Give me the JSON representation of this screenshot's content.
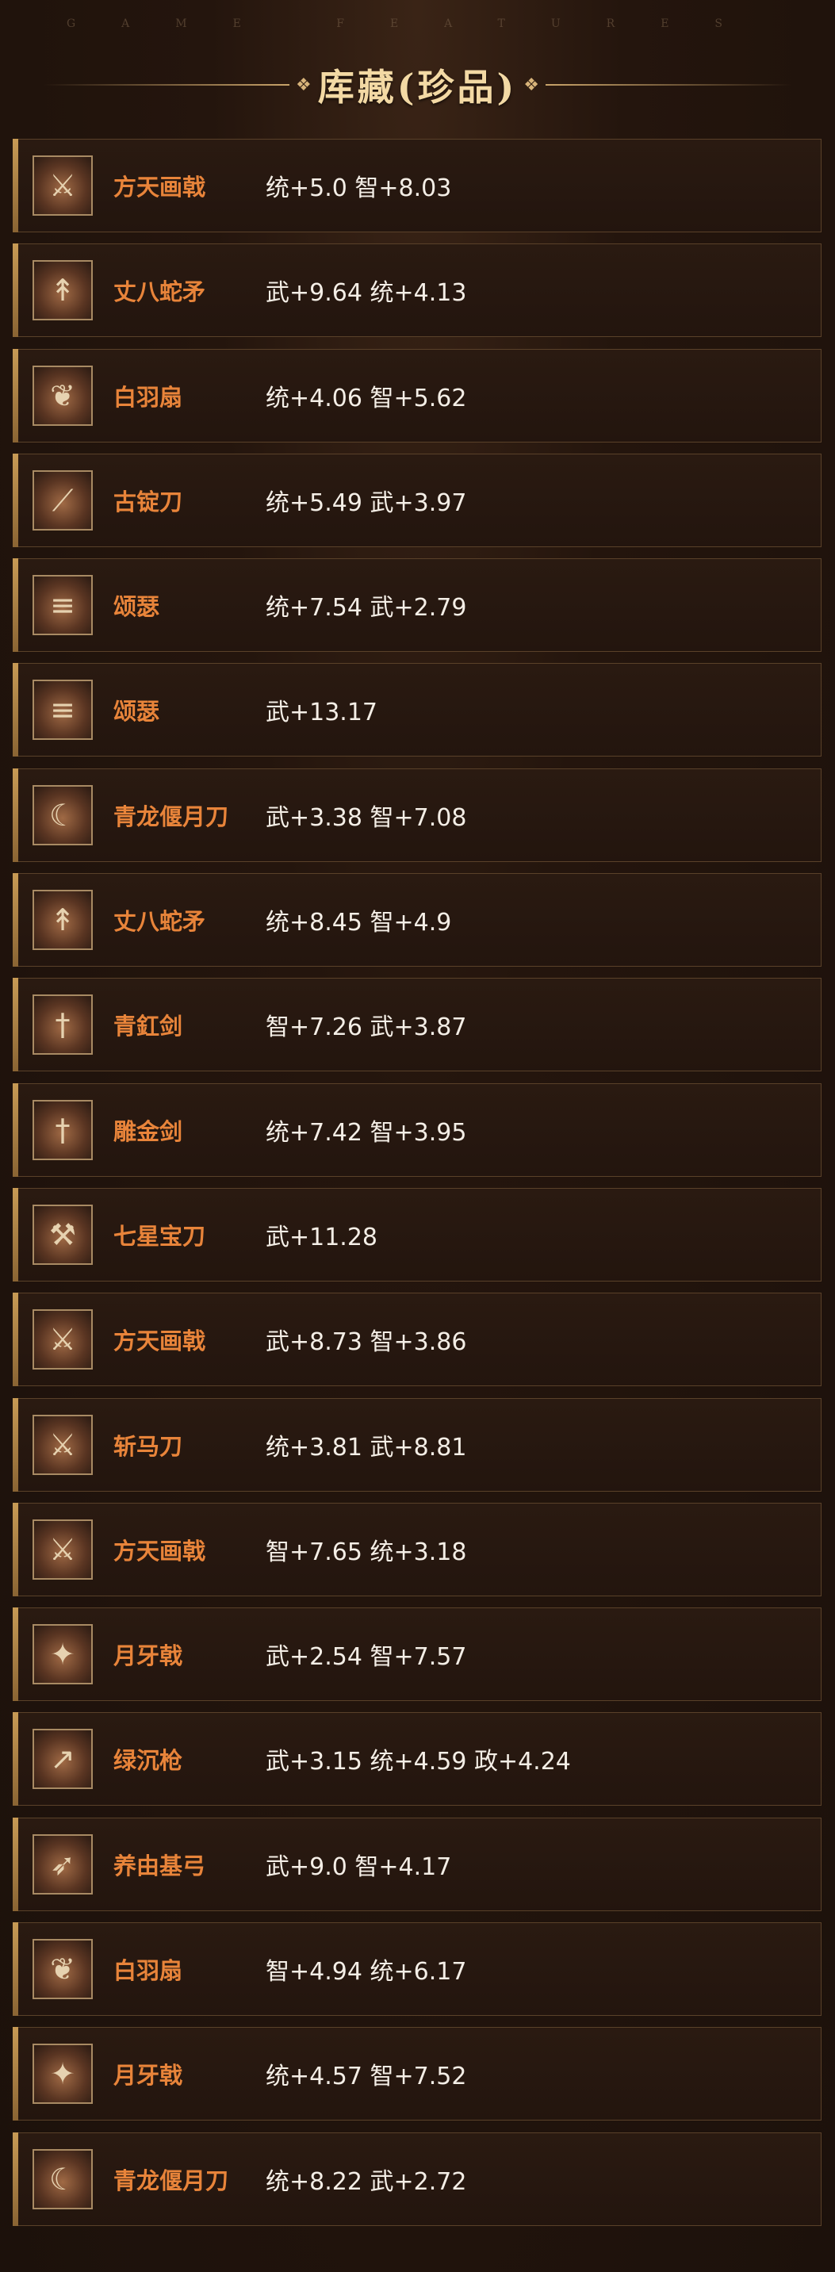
{
  "header": {
    "watermark": "GAME FEATURES",
    "title": "库藏(珍品)"
  },
  "items": [
    {
      "name": "方天画戟",
      "stats": "统+5.0 智+8.03",
      "icon": "halberd-icon"
    },
    {
      "name": "丈八蛇矛",
      "stats": "武+9.64 统+4.13",
      "icon": "serpent-spear-icon"
    },
    {
      "name": "白羽扇",
      "stats": "统+4.06 智+5.62",
      "icon": "feather-fan-icon"
    },
    {
      "name": "古锭刀",
      "stats": "统+5.49 武+3.97",
      "icon": "broadsword-icon"
    },
    {
      "name": "颂瑟",
      "stats": "统+7.54 武+2.79",
      "icon": "zither-icon"
    },
    {
      "name": "颂瑟",
      "stats": "武+13.17",
      "icon": "zither-icon"
    },
    {
      "name": "青龙偃月刀",
      "stats": "武+3.38 智+7.08",
      "icon": "crescent-blade-icon"
    },
    {
      "name": "丈八蛇矛",
      "stats": "统+8.45 智+4.9",
      "icon": "serpent-spear-icon"
    },
    {
      "name": "青釭剑",
      "stats": "智+7.26 武+3.87",
      "icon": "sword-icon"
    },
    {
      "name": "雕金剑",
      "stats": "统+7.42 智+3.95",
      "icon": "sword-icon"
    },
    {
      "name": "七星宝刀",
      "stats": "武+11.28",
      "icon": "dagger-icon"
    },
    {
      "name": "方天画戟",
      "stats": "武+8.73 智+3.86",
      "icon": "halberd-icon"
    },
    {
      "name": "斩马刀",
      "stats": "统+3.81 武+8.81",
      "icon": "horse-cutter-icon"
    },
    {
      "name": "方天画戟",
      "stats": "智+7.65 统+3.18",
      "icon": "halberd-icon"
    },
    {
      "name": "月牙戟",
      "stats": "武+2.54 智+7.57",
      "icon": "crescent-halberd-icon"
    },
    {
      "name": "绿沉枪",
      "stats": "武+3.15 统+4.59 政+4.24",
      "icon": "spear-icon"
    },
    {
      "name": "养由基弓",
      "stats": "武+9.0 智+4.17",
      "icon": "bow-icon"
    },
    {
      "name": "白羽扇",
      "stats": "智+4.94 统+6.17",
      "icon": "feather-fan-icon"
    },
    {
      "name": "月牙戟",
      "stats": "统+4.57 智+7.52",
      "icon": "crescent-halberd-icon"
    },
    {
      "name": "青龙偃月刀",
      "stats": "统+8.22 武+2.72",
      "icon": "crescent-blade-icon"
    }
  ]
}
